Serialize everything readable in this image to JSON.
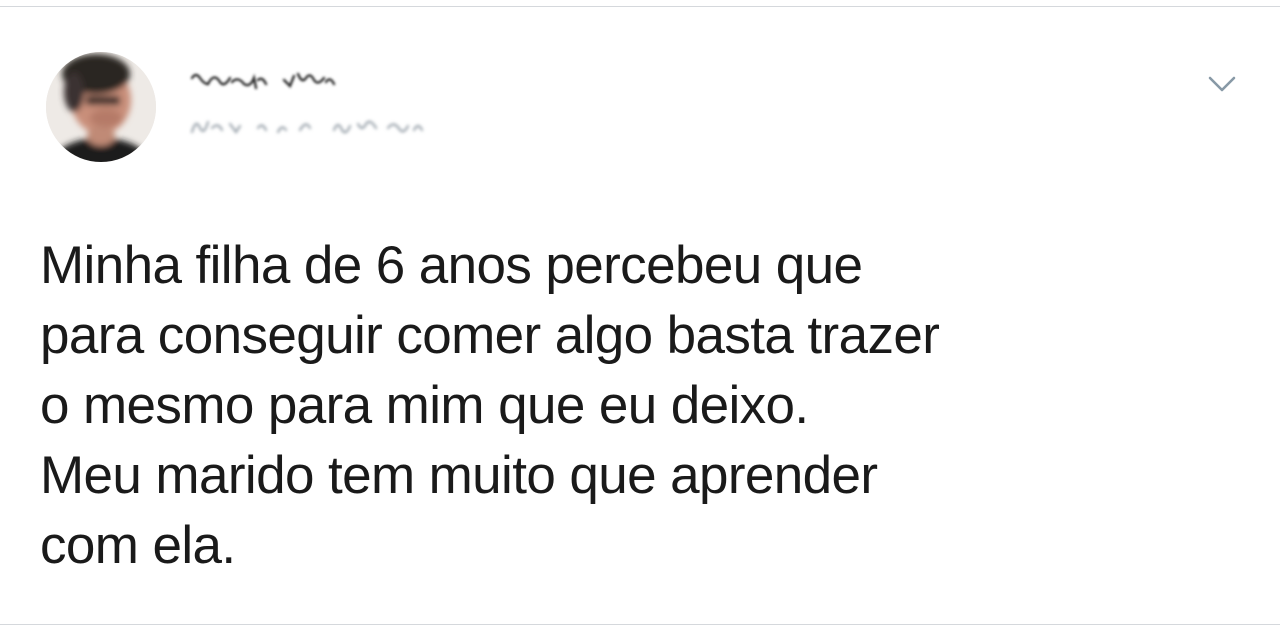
{
  "tweet": {
    "text": "Minha filha de 6 anos percebeu que\npara conseguir comer algo basta trazer\no mesmo para mim que eu deixo.\nMeu marido tem muito que aprender\ncom ela."
  },
  "author": {
    "avatar": "blurred-profile-photo",
    "name_obscured": true,
    "handle_obscured": true
  },
  "icons": {
    "menu": "chevron-down-icon"
  },
  "colors": {
    "text": "#1a1a1a",
    "icon": "#8899a6",
    "divider": "#d5d8dc",
    "background": "#ffffff"
  }
}
